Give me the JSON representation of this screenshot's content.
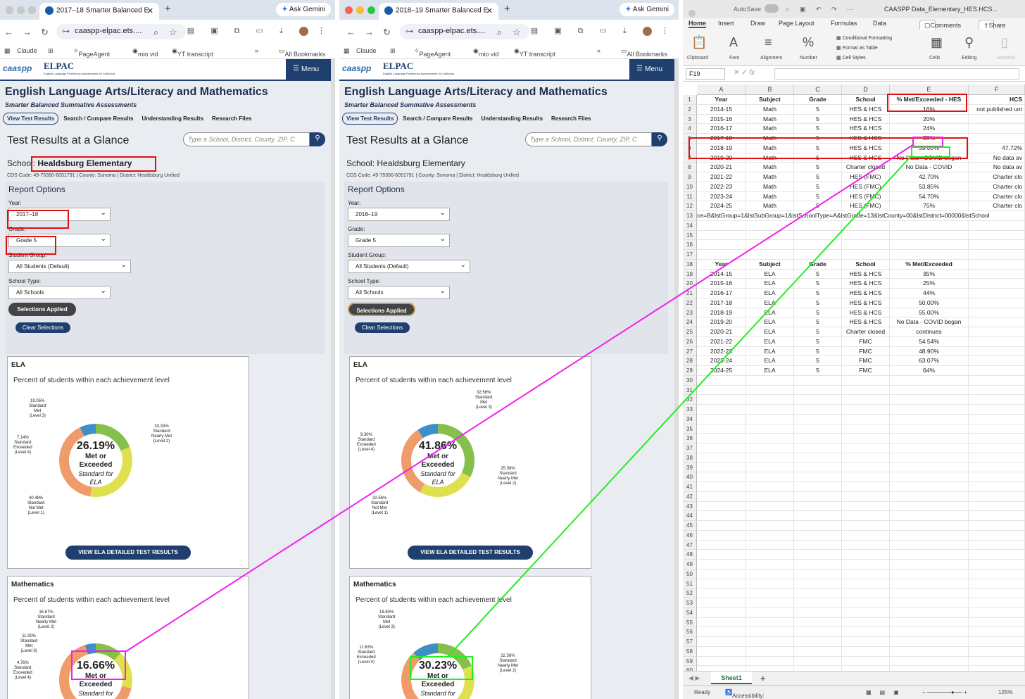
{
  "browser_left": {
    "tab_title": "2017–18 Smarter Balanced E",
    "url": "caaspp-elpac.ets....",
    "gemini": "Ask Gemini",
    "bookmarks": [
      "Claude",
      "PageAgent",
      "mio vid",
      "YT transcript",
      "All Bookmarks"
    ]
  },
  "browser_mid": {
    "tab_title": "2018–19 Smarter Balanced E",
    "url": "caaspp-elpac.ets....",
    "gemini": "Ask Gemini",
    "bookmarks": [
      "Claude",
      "PageAgent",
      "mio vid",
      "YT transcript",
      "All Bookmarks"
    ]
  },
  "site": {
    "logo_caaspp": "caaspp",
    "logo_elpac": "ELPAC",
    "logo_elpac_sub": "English Language Proficiency Assessments for California",
    "menu": "Menu",
    "title": "English Language Arts/Literacy and Mathematics",
    "subtitle": "Smarter Balanced Summative Assessments",
    "nav": [
      "View Test Results",
      "Search / Compare Results",
      "Understanding Results",
      "Research Files"
    ],
    "glance": "Test Results at a Glance",
    "search_placeholder": "Type a School, District, County, ZIP, C",
    "school_label": "School:",
    "school_name": "Healdsburg Elementary",
    "cds": "CDS Code: 49-75390-6051791   |   County: Sonoma   |   District: Healdsburg Unified",
    "report_options": "Report Options",
    "year_label": "Year:",
    "grade_label": "Grade:",
    "group_label": "Student Group:",
    "type_label": "School Type:",
    "grade_value": "Grade 5",
    "group_value": "All Students (Default)",
    "type_value": "All Schools",
    "applied": "Selections Applied",
    "clear": "Clear Selections",
    "ela": "ELA",
    "math": "Mathematics",
    "desc": "Percent of students within each achievement level",
    "met_or": "Met or",
    "exceeded": "Exceeded",
    "standard_for": "Standard for",
    "view_ela": "VIEW ELA DETAILED TEST RESULTS"
  },
  "left_report": {
    "year": "2017–18",
    "ela": {
      "pct": "26.19%",
      "l1": "40.48%",
      "l2": "33.33%",
      "l3": "19.05%",
      "l4": "7.14%"
    },
    "math": {
      "pct": "16.66%",
      "l2": "16.67%",
      "l3": "11.90%",
      "l4": "4.76%"
    }
  },
  "mid_report": {
    "year": "2018–19",
    "ela": {
      "pct": "41.86%",
      "l1": "32.56%",
      "l2": "25.58%",
      "l3": "32.56%",
      "l4": "9.30%"
    },
    "math": {
      "pct": "30.23%",
      "l2": "32.56%",
      "l3": "18.60%",
      "l4": "11.63%"
    }
  },
  "level_names": {
    "l1": [
      "Standard",
      "Not Met",
      "(Level 1)"
    ],
    "l2": [
      "Standard",
      "Nearly Met",
      "(Level 2)"
    ],
    "l3": [
      "Standard",
      "Met",
      "(Level 3)"
    ],
    "l4": [
      "Standard",
      "Exceeded",
      "(Level 4)"
    ]
  },
  "excel": {
    "autosave": "AutoSave",
    "title": "CAASPP Data_Elementary_HES.HCS...",
    "ribbon_tabs": [
      "Home",
      "Insert",
      "Draw",
      "Page Layout",
      "Formulas",
      "Data"
    ],
    "comments": "Comments",
    "share": "Share",
    "groups": [
      "Clipboard",
      "Font",
      "Alignment",
      "Number",
      "Cells",
      "Editing",
      "Sensitivi"
    ],
    "styles": [
      "Conditional Formatting",
      "Format as Table",
      "Cell Styles"
    ],
    "namebox": "F19",
    "columns": [
      "A",
      "B",
      "C",
      "D",
      "E",
      "F"
    ],
    "rows": [
      [
        "Year",
        "Subject",
        "Grade",
        "School",
        "% Met/Exceeded - HES",
        "HCS"
      ],
      [
        "2014-15",
        "Math",
        "5",
        "HES & HCS",
        "16%",
        "not published unt"
      ],
      [
        "2015-16",
        "Math",
        "5",
        "HES & HCS",
        "20%",
        ""
      ],
      [
        "2016-17",
        "Math",
        "5",
        "HES & HCS",
        "24%",
        ""
      ],
      [
        "2017-18",
        "Math",
        "5",
        "HES & HCS",
        "35%",
        ""
      ],
      [
        "2018-19",
        "Math",
        "5",
        "HES & HCS",
        "39.00%",
        "47.72%"
      ],
      [
        "2019-20",
        "Math",
        "5",
        "HES & HCS",
        "No Data - COVID began",
        "No data av"
      ],
      [
        "2020-21",
        "Math",
        "5",
        "Charter closed",
        "No Data - COVID",
        "No data av"
      ],
      [
        "2021-22",
        "Math",
        "5",
        "HES (FMC)",
        "42.70%",
        "Charter clo"
      ],
      [
        "2022-23",
        "Math",
        "5",
        "HES (FMC)",
        "53.85%",
        "Charter clo"
      ],
      [
        "2023-24",
        "Math",
        "5",
        "HES (FMC)",
        "54.70%",
        "Charter clo"
      ],
      [
        "2024-25",
        "Math",
        "5",
        "HES (FMC)",
        "75%",
        "Charter clo"
      ],
      [
        "ce=B&lstGroup=1&lstSubGroup=1&lstSchoolType=A&lstGrade=13&lstCounty=00&lstDistrict=00000&lstSchool",
        "",
        "",
        "",
        "",
        ""
      ],
      [
        "",
        "",
        "",
        "",
        "",
        ""
      ],
      [
        "",
        "",
        "",
        "",
        "",
        ""
      ],
      [
        "",
        "",
        "",
        "",
        "",
        ""
      ],
      [
        "",
        "",
        "",
        "",
        "",
        ""
      ],
      [
        "Year",
        "Subject",
        "Grade",
        "School",
        "% Met/Exceeded",
        ""
      ],
      [
        "2014-15",
        "ELA",
        "5",
        "HES & HCS",
        "35%",
        ""
      ],
      [
        "2015-16",
        "ELA",
        "5",
        "HES & HCS",
        "25%",
        ""
      ],
      [
        "2016-17",
        "ELA",
        "5",
        "HES & HCS",
        "44%",
        ""
      ],
      [
        "2017-18",
        "ELA",
        "5",
        "HES & HCS",
        "50.00%",
        ""
      ],
      [
        "2018-19",
        "ELA",
        "5",
        "HES & HCS",
        "55.00%",
        ""
      ],
      [
        "2019-20",
        "ELA",
        "5",
        "HES & HCS",
        "No Data - COVID began",
        ""
      ],
      [
        "2020-21",
        "ELA",
        "5",
        "Charter closed",
        "continues",
        ""
      ],
      [
        "2021-22",
        "ELA",
        "5",
        "FMC",
        "54.54%",
        ""
      ],
      [
        "2022-23",
        "ELA",
        "5",
        "FMC",
        "48.90%",
        ""
      ],
      [
        "2023-24",
        "ELA",
        "5",
        "FMC",
        "63.07%",
        ""
      ],
      [
        "2024-25",
        "ELA",
        "5",
        "FMC",
        "64%",
        ""
      ]
    ],
    "sheet": "Sheet1",
    "status_ready": "Ready",
    "status_access": "Accessibility: Good to go",
    "zoom": "125%"
  },
  "colors": {
    "l1": "#ef9b6a",
    "l2": "#dfe04e",
    "l3": "#86bf4b",
    "l4": "#3e8fc8",
    "navy": "#1f3f6e",
    "red": "#e01010",
    "magenta": "#ee22ee",
    "green": "#22ee22"
  }
}
